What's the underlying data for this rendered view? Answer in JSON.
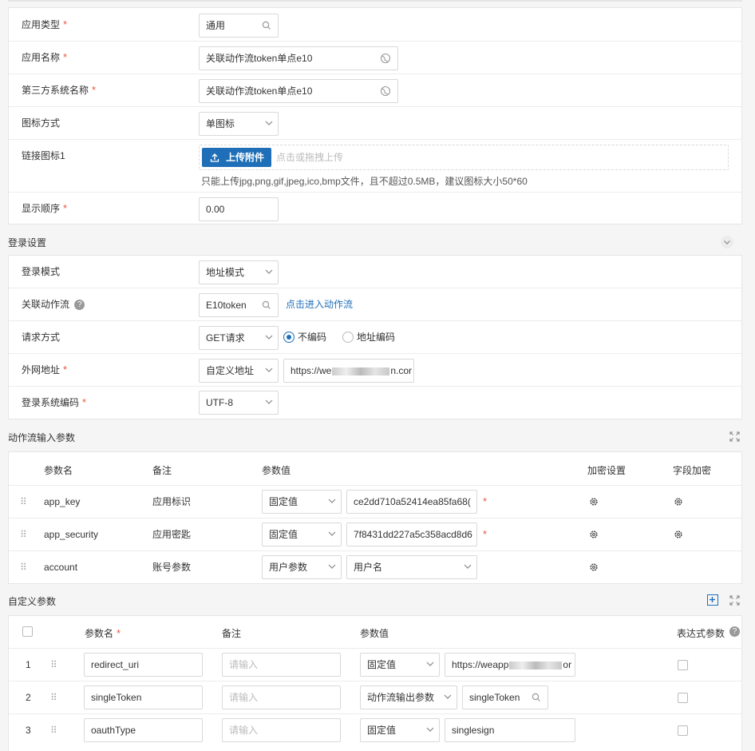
{
  "basic": {
    "app_type_label": "应用类型",
    "app_type_value": "通用",
    "app_name_label": "应用名称",
    "app_name_value": "关联动作流token单点e10",
    "third_party_label": "第三方系统名称",
    "third_party_value": "关联动作流token单点e10",
    "icon_mode_label": "图标方式",
    "icon_mode_value": "单图标",
    "link_icon_label": "链接图标1",
    "upload_button": "上传附件",
    "upload_hint": "点击或拖拽上传",
    "upload_note": "只能上传jpg,png,gif,jpeg,ico,bmp文件，且不超过0.5MB，建议图标大小50*60",
    "order_label": "显示顺序",
    "order_value": "0.00",
    "required_mark": "*"
  },
  "login": {
    "section_title": "登录设置",
    "mode_label": "登录模式",
    "mode_value": "地址模式",
    "flow_label": "关联动作流",
    "flow_value": "E10token",
    "flow_link": "点击进入动作流",
    "method_label": "请求方式",
    "method_value": "GET请求",
    "radio_no_encode": "不编码",
    "radio_addr_encode": "地址编码",
    "url_label": "外网地址",
    "url_type_value": "自定义地址",
    "url_value": "https://we",
    "url_value_tail": "n.cor",
    "encoding_label": "登录系统编码",
    "encoding_value": "UTF-8"
  },
  "flow_params": {
    "section_title": "动作流输入参数",
    "headers": [
      "参数名",
      "备注",
      "参数值",
      "加密设置",
      "字段加密"
    ],
    "rows": [
      {
        "name": "app_key",
        "note": "应用标识",
        "type": "固定值",
        "value": "ce2dd710a52414ea85fa68("
      },
      {
        "name": "app_security",
        "note": "应用密匙",
        "type": "固定值",
        "value": "7f8431dd227a5c358acd8d6"
      },
      {
        "name": "account",
        "note": "账号参数",
        "type": "用户参数",
        "value": "用户名"
      }
    ]
  },
  "custom_params": {
    "section_title": "自定义参数",
    "headers": [
      "参数名",
      "备注",
      "参数值",
      "表达式参数"
    ],
    "placeholder": "请输入",
    "rows": [
      {
        "index": "1",
        "name": "redirect_uri",
        "type": "固定值",
        "value": "https://weapp",
        "value_tail": "or"
      },
      {
        "index": "2",
        "name": "singleToken",
        "type": "动作流输出参数",
        "value": "singleToken"
      },
      {
        "index": "3",
        "name": "oauthType",
        "type": "固定值",
        "value": "singlesign"
      }
    ]
  }
}
